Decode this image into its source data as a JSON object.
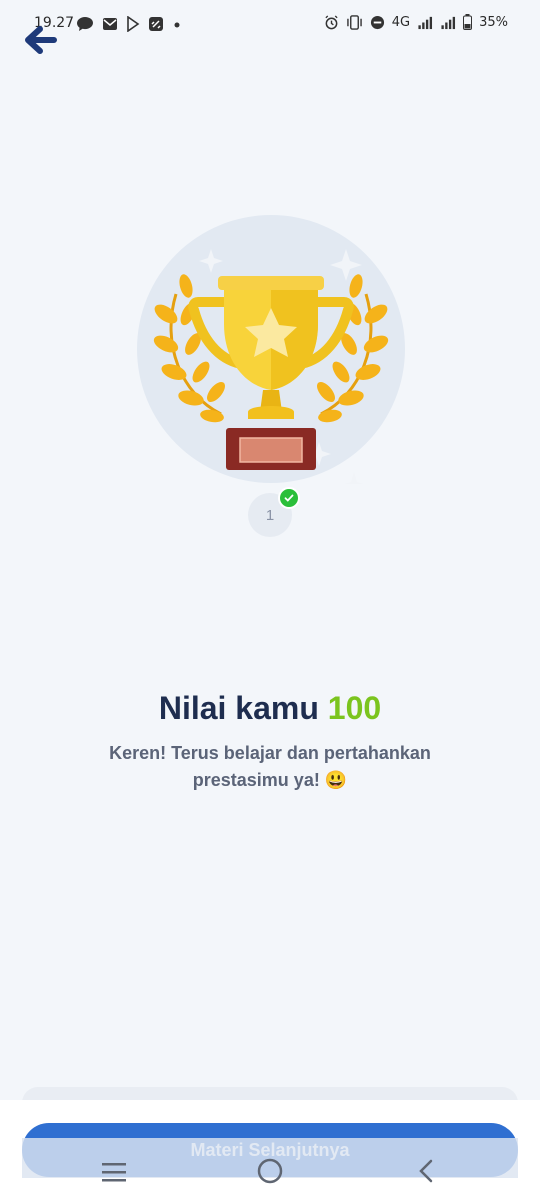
{
  "status_bar": {
    "time": "19.27",
    "network": "4G",
    "battery": "35%",
    "icons": [
      "message-icon",
      "mail-icon",
      "play-icon",
      "link-icon",
      "dot-icon",
      "alarm-icon",
      "vibrate-icon",
      "dnd-icon",
      "signal-icon",
      "battery-icon"
    ]
  },
  "header": {
    "back_icon": "back-arrow-icon"
  },
  "trophy": {
    "icon": "trophy-icon",
    "step_number": "1",
    "step_status_icon": "check-circle-icon"
  },
  "result": {
    "title_prefix": "Nilai kamu",
    "score": "100",
    "message_line1": "Keren! Terus belajar dan pertahankan",
    "message_line2": "prestasimu ya! 😃"
  },
  "footer": {
    "next_label": "Materi Selanjutnya"
  },
  "nav_bar": {
    "icons": [
      "recent-apps-icon",
      "home-icon",
      "nav-back-icon"
    ]
  },
  "colors": {
    "accent": "#2f6fd1",
    "score": "#7bc41e",
    "title": "#1e2d4f",
    "background": "#f3f6fa"
  }
}
